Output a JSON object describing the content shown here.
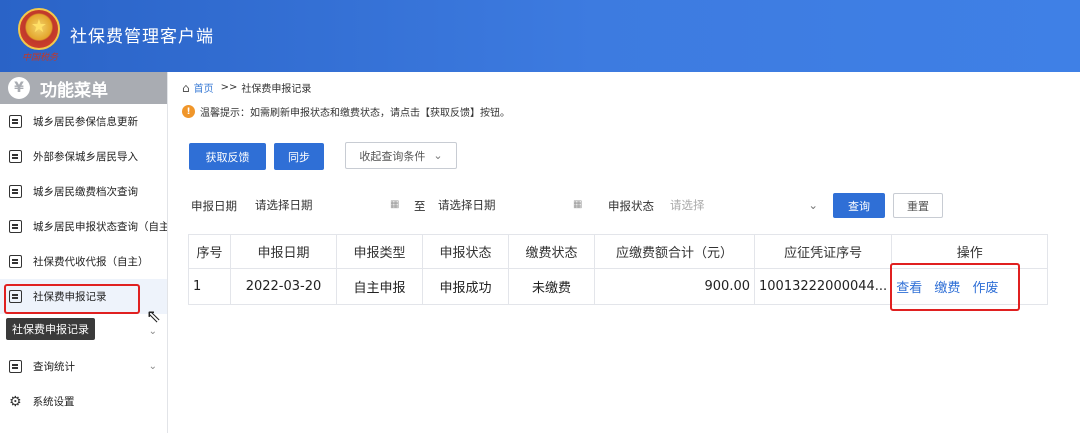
{
  "app": {
    "title": "社保费管理客户端",
    "emblem_caption": "中国税务"
  },
  "sidebar": {
    "header": "功能菜单",
    "items": [
      {
        "label": "城乡居民参保信息更新"
      },
      {
        "label": "外部参保城乡居民导入"
      },
      {
        "label": "城乡居民缴费档次查询"
      },
      {
        "label": "城乡居民申报状态查询（自主"
      },
      {
        "label": "社保费代收代报（自主）"
      },
      {
        "label": "社保费申报记录"
      },
      {
        "label": "查询统计"
      },
      {
        "label": "系统设置"
      }
    ],
    "tooltip": "社保费申报记录"
  },
  "breadcrumb": {
    "home": "首页",
    "sep": ">>",
    "current": "社保费申报记录"
  },
  "tip": {
    "text": "温馨提示：如需刷新申报状态和缴费状态，请点击【获取反馈】按钮。"
  },
  "toolbar": {
    "fetch_feedback": "获取反馈",
    "sync": "同步",
    "collapse_query": "收起查询条件"
  },
  "filters": {
    "date_label": "申报日期",
    "date_start_placeholder": "请选择日期",
    "to_label": "至",
    "date_end_placeholder": "请选择日期",
    "status_label": "申报状态",
    "status_placeholder": "请选择",
    "query_button": "查询",
    "reset_button": "重置"
  },
  "table": {
    "columns": [
      "序号",
      "申报日期",
      "申报类型",
      "申报状态",
      "缴费状态",
      "应缴费额合计（元）",
      "应征凭证序号",
      "操作"
    ],
    "rows": [
      {
        "index": "1",
        "date": "2022-03-20",
        "type": "自主申报",
        "status": "申报成功",
        "pay_status": "未缴费",
        "amount": "900.00",
        "voucher": "10013222000044...",
        "ops": [
          "查看",
          "缴费",
          "作废"
        ]
      }
    ]
  }
}
